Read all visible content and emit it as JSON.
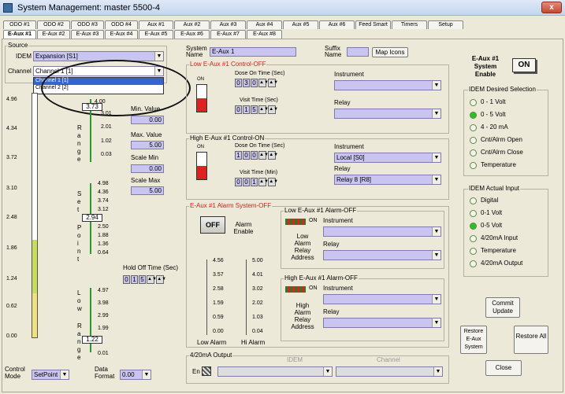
{
  "window": {
    "title": "System Management: master 5500-4",
    "close_label": "x"
  },
  "tabs_row1": [
    "ODO #1",
    "ODO #2",
    "ODO #3",
    "ODO #4",
    "Aux #1",
    "Aux #2",
    "Aux #3",
    "Aux #4",
    "Aux #5",
    "Aux #6",
    "Feed Smart",
    "Timers",
    "Setup"
  ],
  "tabs_row2": [
    "E-Aux #1",
    "E-Aux #2",
    "E-Aux #3",
    "E-Aux #4",
    "E-Aux #5",
    "E-Aux #6",
    "E-Aux #7",
    "E-Aux #8"
  ],
  "source": {
    "group_label": "Source",
    "idem_label": "IDEM",
    "idem_value": "Expansion [S1]",
    "channel_label": "Channel",
    "channel_value": "Channel 1 [1]",
    "dropdown_options": [
      "Channel 1 [1]",
      "Channel 2 [2]"
    ]
  },
  "left_scale": {
    "ticks": [
      "4.96",
      "4.34",
      "3.72",
      "3.10",
      "2.48",
      "1.86",
      "1.24",
      "0.62",
      "0.00"
    ]
  },
  "range_scale": {
    "letters": [
      "R",
      "a",
      "n",
      "g",
      "e"
    ],
    "top": "4.00",
    "ticks": [
      "3.73",
      "3.01",
      "2.01",
      "1.02",
      "0.03"
    ],
    "slider": "3.73"
  },
  "setpoint_scale": {
    "letters": [
      "S",
      "e",
      "t",
      "P",
      "o",
      "i",
      "n",
      "t"
    ],
    "ticks": [
      "4.98",
      "4.36",
      "3.74",
      "3.12",
      "2.50",
      "1.88",
      "1.36",
      "0.64"
    ],
    "slider": "2.94"
  },
  "low_range_scale": {
    "letters": [
      "L",
      "o",
      "w",
      "",
      "R",
      "a",
      "n",
      "g",
      "e"
    ],
    "ticks": [
      "4.97",
      "3.98",
      "2.99",
      "1.99",
      "1.00",
      "0.01"
    ],
    "slider": "1.22"
  },
  "min_value": {
    "label": "Min. Value",
    "value": "0.00"
  },
  "max_value": {
    "label": "Max. Value",
    "value": "5.00"
  },
  "scale_min": {
    "label": "Scale Min",
    "value": "0.00"
  },
  "scale_max": {
    "label": "Scale Max",
    "value": "5.00"
  },
  "holdoff": {
    "label": "Hold Off Time (Sec)",
    "digits": [
      "0",
      "1",
      "5"
    ]
  },
  "control_mode": {
    "label": "Control Mode",
    "value": "SetPoint"
  },
  "data_format": {
    "label": "Data Format",
    "value": "0.00"
  },
  "system_name": {
    "label": "System Name",
    "value": "E-Aux 1"
  },
  "suffix_name": {
    "label": "Suffix Name",
    "value": ""
  },
  "map_icons": {
    "label": "Map Icons"
  },
  "low_control": {
    "title": "Low E-Aux #1 Control-OFF",
    "dose_on_label": "Dose On Time (Sec)",
    "dose_on_digits": [
      "0",
      "3",
      "0"
    ],
    "visit_label": "Visit Time (Sec)",
    "visit_digits": [
      "0",
      "1",
      "5"
    ],
    "instrument_label": "Instrument",
    "relay_label": "Relay",
    "on_label": "ON"
  },
  "high_control": {
    "title": "High E-Aux #1 Control-ON",
    "dose_on_label": "Dose On Time (Sec)",
    "dose_on_digits": [
      "1",
      "0",
      "0"
    ],
    "visit_label": "Visit Time (Min)",
    "visit_digits": [
      "0",
      "0",
      "1"
    ],
    "instrument_label": "Instrument",
    "instrument_value": "Local [S0]",
    "relay_label": "Relay",
    "relay_value": "Relay 8 [R8]",
    "on_label": "ON"
  },
  "alarm_system": {
    "title": "E-Aux #1 Alarm System-OFF",
    "off_label": "OFF",
    "enable_label": "Alarm Enable",
    "low_scale_label": "Low Alarm",
    "hi_scale_label": "Hi Alarm",
    "low_ticks": [
      "4.56",
      "3.57",
      "2.58",
      "1.59",
      "0.59",
      "0.00"
    ],
    "hi_ticks": [
      "5.00",
      "4.01",
      "3.02",
      "2.02",
      "1.03",
      "0.04"
    ]
  },
  "low_alarm": {
    "title": "Low E-Aux #1 Alarm-OFF",
    "on_label": "ON",
    "instrument_label": "Instrument",
    "relay_label": "Relay",
    "side_label": "Low Alarm Relay Address"
  },
  "high_alarm": {
    "title": "High E-Aux #1 Alarm-OFF",
    "on_label": "ON",
    "instrument_label": "Instrument",
    "relay_label": "Relay",
    "side_label": "High Alarm Relay Address"
  },
  "output_420": {
    "title": "4/20mA Output",
    "en_label": "En",
    "idem_col": "IDEM",
    "channel_col": "Channel"
  },
  "enable_box": {
    "label": "E-Aux #1 System Enable",
    "value": "ON"
  },
  "desired_selection": {
    "title": "IDEM Desired Selection",
    "items": [
      {
        "label": "0 - 1 Volt",
        "on": false
      },
      {
        "label": "0 - 5 Volt",
        "on": true
      },
      {
        "label": "4 - 20 mA",
        "on": false
      },
      {
        "label": "Cnt/Alrm Open",
        "on": false
      },
      {
        "label": "Cnt/Alrm Close",
        "on": false
      },
      {
        "label": "Temperature",
        "on": false
      }
    ]
  },
  "actual_input": {
    "title": "IDEM Actual Input",
    "items": [
      {
        "label": "Digital",
        "on": false
      },
      {
        "label": "0-1 Volt",
        "on": false
      },
      {
        "label": "0-5 Volt",
        "on": true
      },
      {
        "label": "4/20mA Input",
        "on": false
      },
      {
        "label": "Temperature",
        "on": false
      },
      {
        "label": "4/20mA Output",
        "on": false
      }
    ]
  },
  "buttons": {
    "commit": "Commit Update",
    "restore_eaux": "Restore E-Aux System",
    "restore_all": "Restore All",
    "close": "Close"
  }
}
